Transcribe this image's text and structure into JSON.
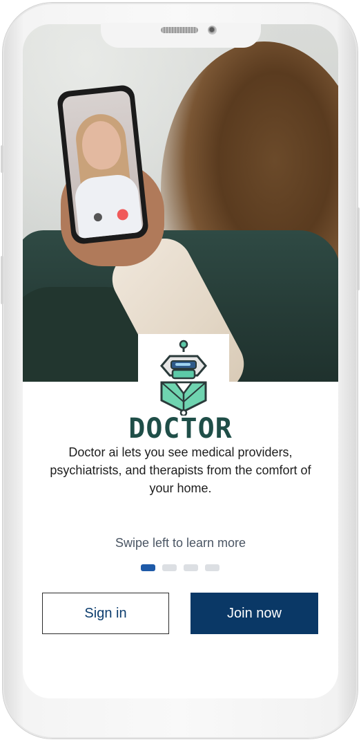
{
  "brand": {
    "name": "DOCTOR",
    "color": "#1f4e48",
    "logo_icon": "robot-doctor-logo"
  },
  "hero": {
    "image": "woman-video-call-photo"
  },
  "onboarding": {
    "description": "Doctor ai lets you see medical providers, psychiatrists, and therapists from the comfort of your home.",
    "swipe_hint": "Swipe left to learn more",
    "pager": {
      "total": 4,
      "active_index": 0,
      "active_color": "#1e5aa8",
      "inactive_color": "#dcdfe3"
    }
  },
  "actions": {
    "sign_in_label": "Sign in",
    "join_label": "Join now",
    "primary_color": "#0a3866"
  }
}
